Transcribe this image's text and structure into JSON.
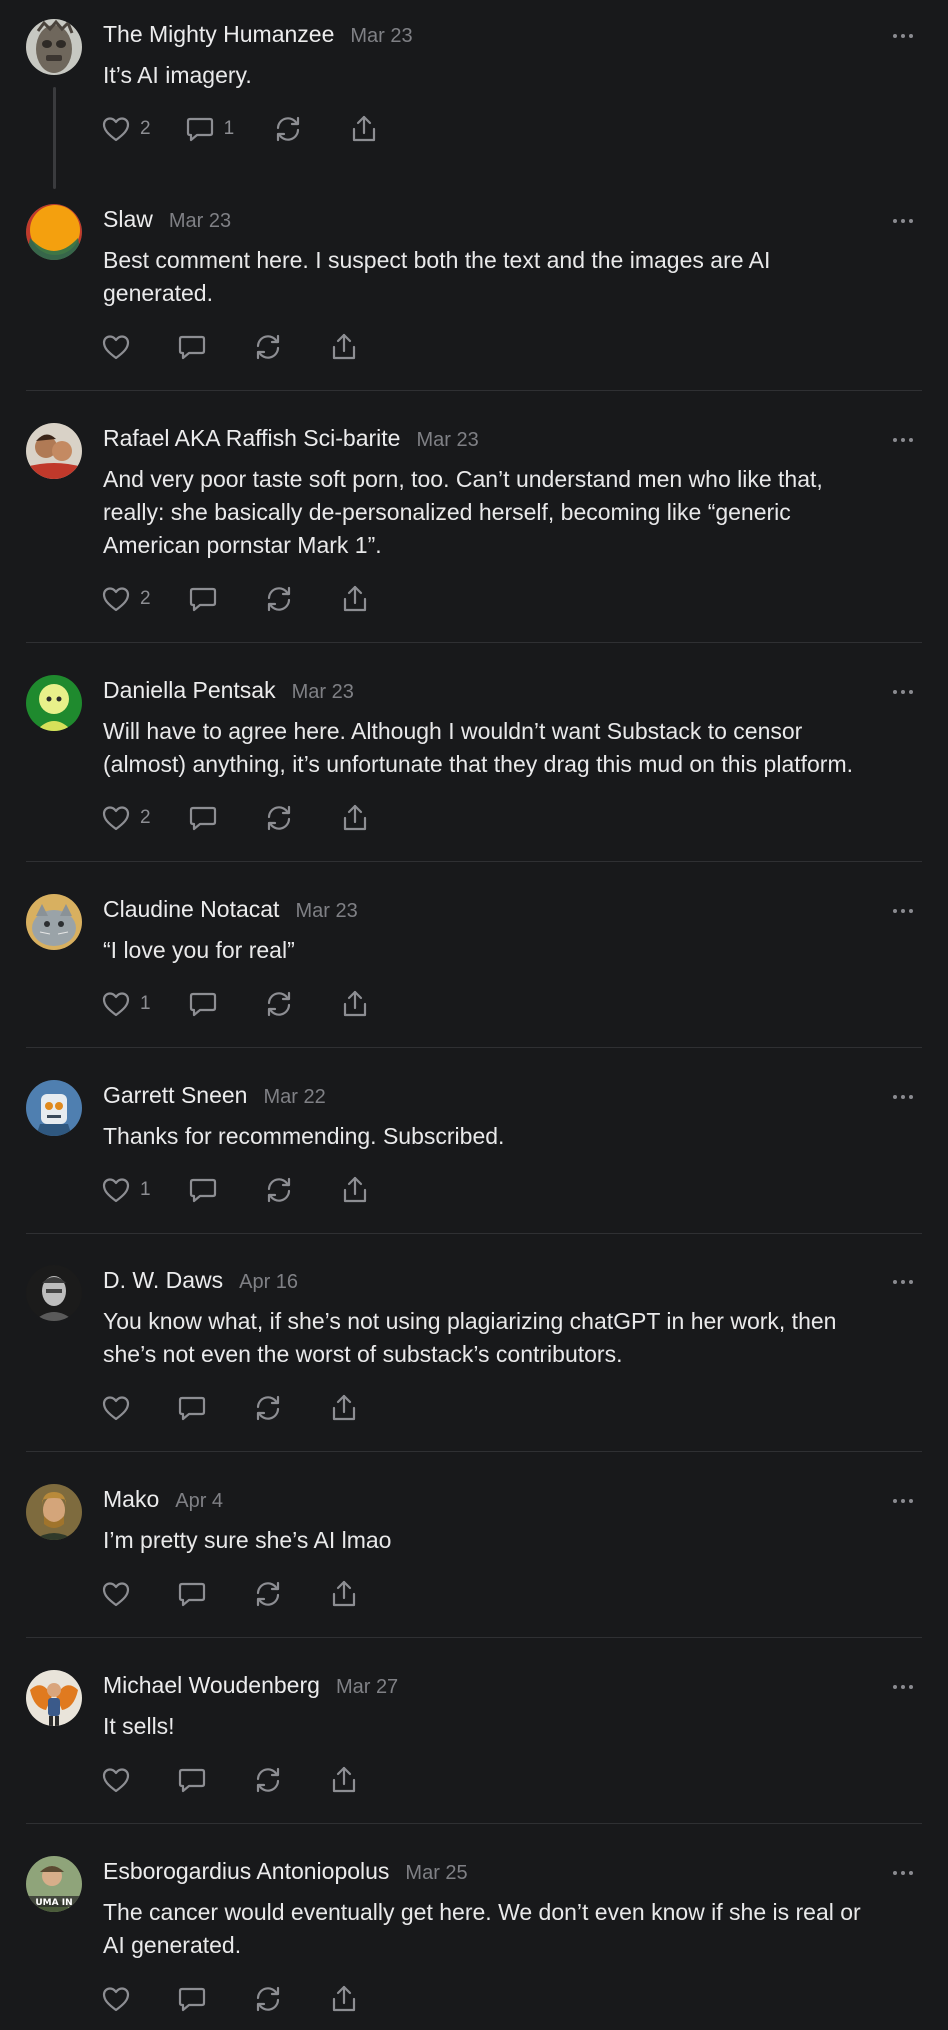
{
  "comments": [
    {
      "author": "The Mighty Humanzee",
      "date": "Mar 23",
      "lines": [
        "It’s AI imagery."
      ],
      "likes": "2",
      "replies": "1",
      "avatar": "stone-statue"
    },
    {
      "author": "Slaw",
      "date": "Mar 23",
      "lines": [
        "Best comment here. I suspect both the text and the images are AI",
        "generated."
      ],
      "likes": "",
      "replies": "",
      "avatar": "orange-circle"
    },
    {
      "author": "Rafael AKA Raffish Sci-barite",
      "date": "Mar 23",
      "lines": [
        "And very poor taste soft porn, too. Can’t understand men who like that,",
        "really: she basically de-personalized herself, becoming like “generic",
        "American pornstar Mark 1”."
      ],
      "likes": "2",
      "replies": "",
      "avatar": "two-people-photo"
    },
    {
      "author": "Daniella Pentsak",
      "date": "Mar 23",
      "lines": [
        "Will have to agree here. Although I wouldn’t want Substack to censor",
        "(almost) anything, it’s unfortunate that they drag this mud on this platform."
      ],
      "likes": "2",
      "replies": "",
      "avatar": "green-portrait"
    },
    {
      "author": "Claudine Notacat",
      "date": "Mar 23",
      "lines": [
        "“I love you for real”"
      ],
      "likes": "1",
      "replies": "",
      "avatar": "cat-photo"
    },
    {
      "author": "Garrett Sneen",
      "date": "Mar 22",
      "lines": [
        "Thanks for recommending. Subscribed."
      ],
      "likes": "1",
      "replies": "",
      "avatar": "robot-illustration"
    },
    {
      "author": "D. W. Daws",
      "date": "Apr 16",
      "lines": [
        "You know what, if she’s not using plagiarizing chatGPT in her work, then",
        "she’s not even the worst of substack’s contributors."
      ],
      "likes": "",
      "replies": "",
      "avatar": "bw-portrait"
    },
    {
      "author": "Mako",
      "date": "Apr 4",
      "lines": [
        "I’m pretty sure she’s AI lmao"
      ],
      "likes": "",
      "replies": "",
      "avatar": "man-portrait"
    },
    {
      "author": "Michael Woudenberg",
      "date": "Mar 27",
      "lines": [
        "It sells!"
      ],
      "likes": "",
      "replies": "",
      "avatar": "butterfly-portrait"
    },
    {
      "author": "Esborogardius Antoniopolus",
      "date": "Mar 25",
      "lines": [
        "The cancer would eventually get here. We don’t even know if she is real or",
        "AI generated."
      ],
      "likes": "",
      "replies": "",
      "avatar": "person-photo"
    }
  ],
  "avatar_text": {
    "esborogardius": "UMA IN"
  },
  "icons": {
    "like": "heart-icon",
    "reply": "speech-bubble-icon",
    "restack": "restack-icon",
    "share": "share-icon",
    "more": "more-dots-icon"
  },
  "colors": {
    "background": "#18191b",
    "text": "#e9e9ea",
    "muted": "#7f8085",
    "divider": "#2f3033"
  }
}
